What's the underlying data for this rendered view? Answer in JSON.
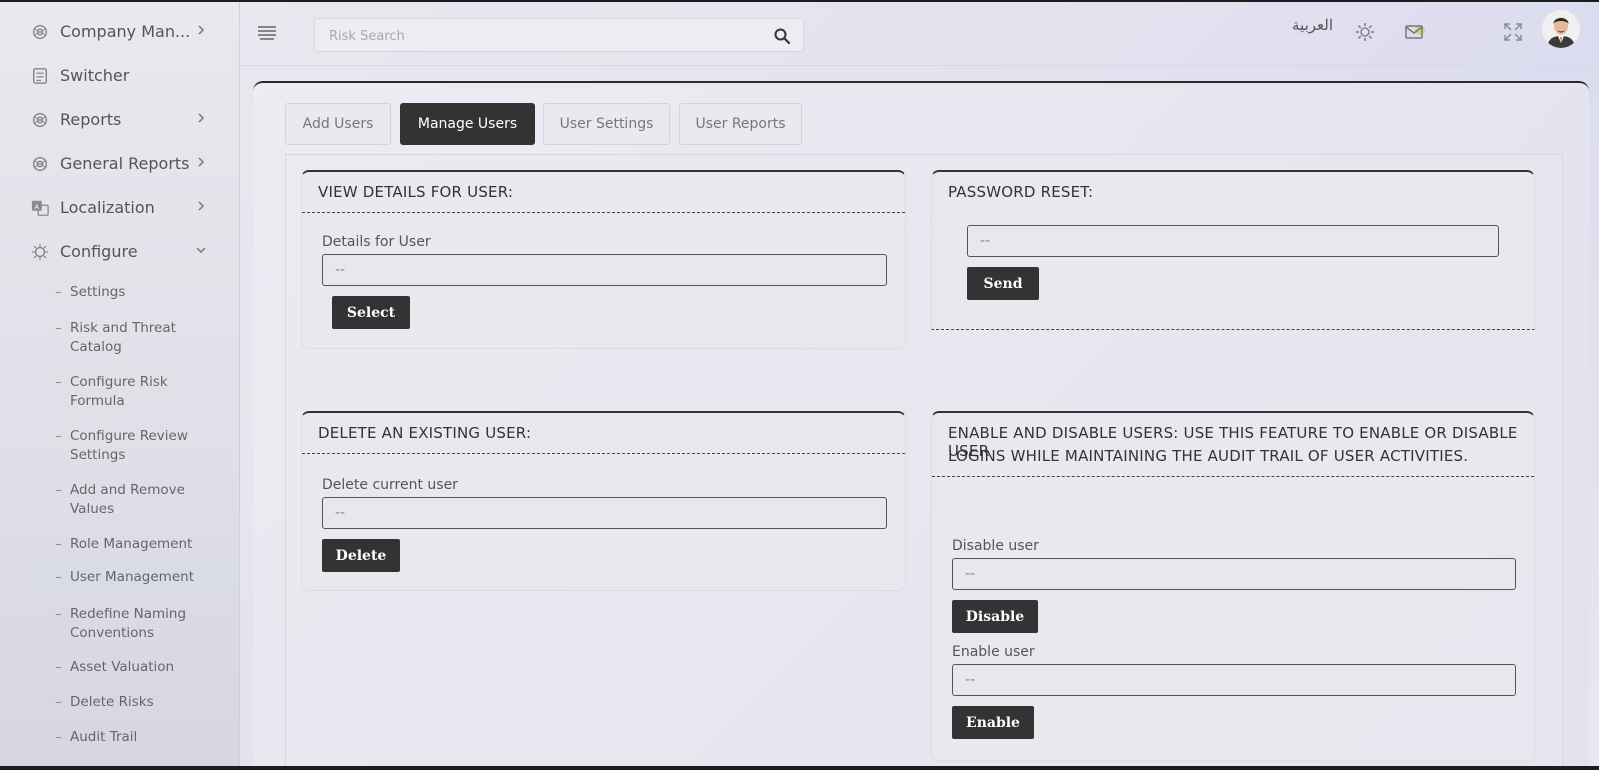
{
  "sidebar": {
    "items": [
      {
        "label": "Company Man...",
        "icon": "gear-cog-icon",
        "has_chevron": true
      },
      {
        "label": "Switcher",
        "icon": "switcher-icon",
        "has_chevron": false
      },
      {
        "label": "Reports",
        "icon": "gear-cog-icon",
        "has_chevron": true
      },
      {
        "label": "General Reports",
        "icon": "gear-cog-icon",
        "has_chevron": true
      },
      {
        "label": "Localization",
        "icon": "translate-icon",
        "has_chevron": true
      },
      {
        "label": "Configure",
        "icon": "gear-icon",
        "has_chevron": true,
        "expanded": true
      }
    ],
    "subitems": [
      {
        "label": "Settings"
      },
      {
        "label": "Risk and Threat Catalog"
      },
      {
        "label": "Configure Risk Formula"
      },
      {
        "label": "Configure Review Settings"
      },
      {
        "label": "Add and Remove Values"
      },
      {
        "label": "Role Management"
      },
      {
        "label": "User Management",
        "active": true
      },
      {
        "label": "Redefine Naming Conventions"
      },
      {
        "label": "Asset Valuation"
      },
      {
        "label": "Delete Risks"
      },
      {
        "label": "Audit Trail"
      }
    ],
    "dash": "–"
  },
  "topbar": {
    "search_placeholder": "Risk Search",
    "language": "العربية",
    "icons": [
      "menu-icon",
      "search-icon",
      "settings-icon",
      "mail-icon",
      "fullscreen-icon",
      "avatar"
    ]
  },
  "tabs": [
    {
      "label": "Add Users",
      "active": false
    },
    {
      "label": "Manage Users",
      "active": true
    },
    {
      "label": "User Settings",
      "active": false
    },
    {
      "label": "User Reports",
      "active": false
    }
  ],
  "view_details": {
    "title": "VIEW DETAILS FOR USER:",
    "field_label": "Details for User",
    "value": "--",
    "button": "Select"
  },
  "password_reset": {
    "title": "PASSWORD RESET:",
    "value": "--",
    "button": "Send"
  },
  "delete_user": {
    "title": "DELETE AN EXISTING USER:",
    "field_label": "Delete current user",
    "value": "--",
    "button": "Delete"
  },
  "enable_disable": {
    "title_line1": "ENABLE AND DISABLE USERS: USE THIS FEATURE TO ENABLE OR DISABLE USER",
    "title_line2": "LOGINS WHILE MAINTAINING THE AUDIT TRAIL OF USER ACTIVITIES.",
    "disable_label": "Disable user",
    "disable_value": "--",
    "disable_button": "Disable",
    "enable_label": "Enable user",
    "enable_value": "--",
    "enable_button": "Enable"
  },
  "colors": {
    "dark_button": "#333333",
    "accent_mail": "#c5d66a"
  }
}
